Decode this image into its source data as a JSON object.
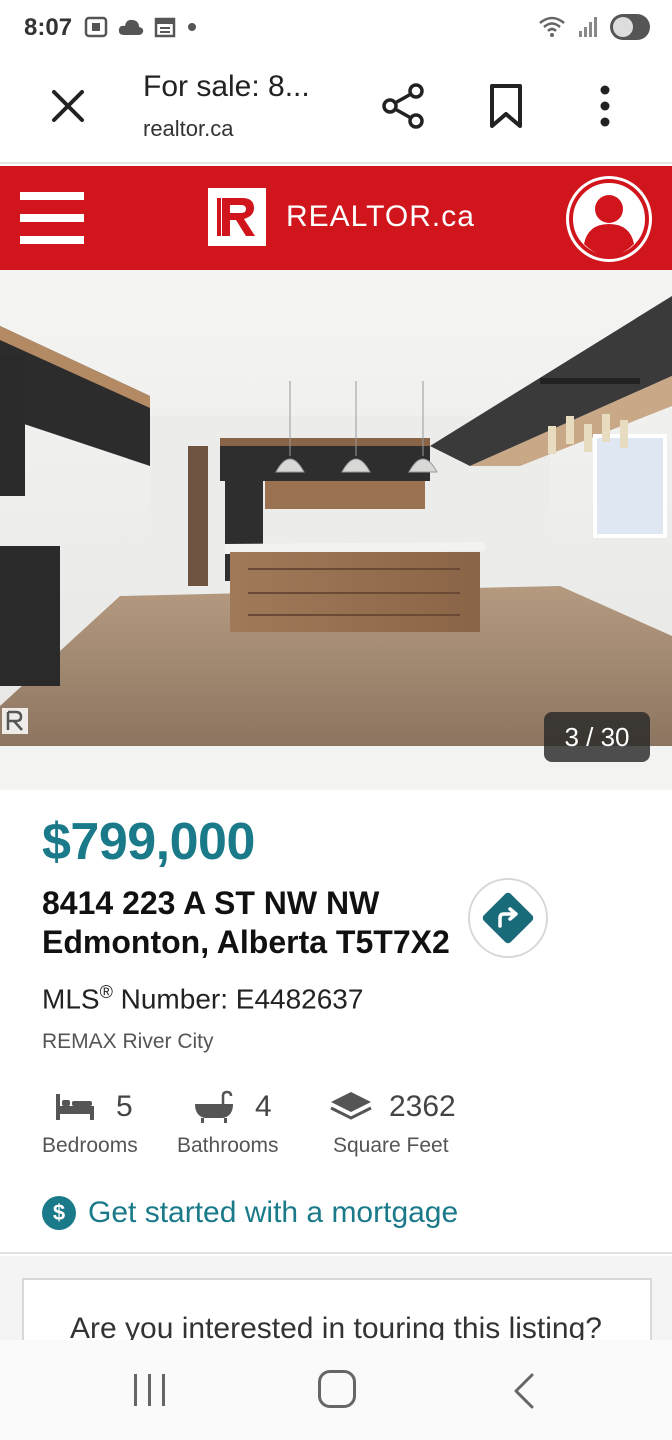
{
  "status_bar": {
    "time": "8:07"
  },
  "browser": {
    "page_title": "For sale: 8...",
    "url": "realtor.ca"
  },
  "header": {
    "logo_text": "REALTOR.ca",
    "brand_color": "#d0161c"
  },
  "gallery": {
    "counter": "3 / 30"
  },
  "listing": {
    "price": "$799,000",
    "address_line1": "8414 223 A ST NW NW",
    "address_line2": "Edmonton, Alberta T5T7X2",
    "mls_prefix": "MLS",
    "mls_mark": "®",
    "mls_number": " Number: E4482637",
    "brokerage": "REMAX River City",
    "price_color": "#1a7a8a"
  },
  "stats": {
    "bedrooms": {
      "value": "5",
      "label": "Bedrooms",
      "icon": "bed-icon"
    },
    "bathrooms": {
      "value": "4",
      "label": "Bathrooms",
      "icon": "bathtub-icon"
    },
    "sqft": {
      "value": "2362",
      "label": "Square Feet",
      "icon": "layers-icon"
    }
  },
  "mortgage": {
    "icon_text": "$",
    "label": "Get started with a mortgage"
  },
  "tour": {
    "question": "Are you interested in touring this listing?"
  }
}
